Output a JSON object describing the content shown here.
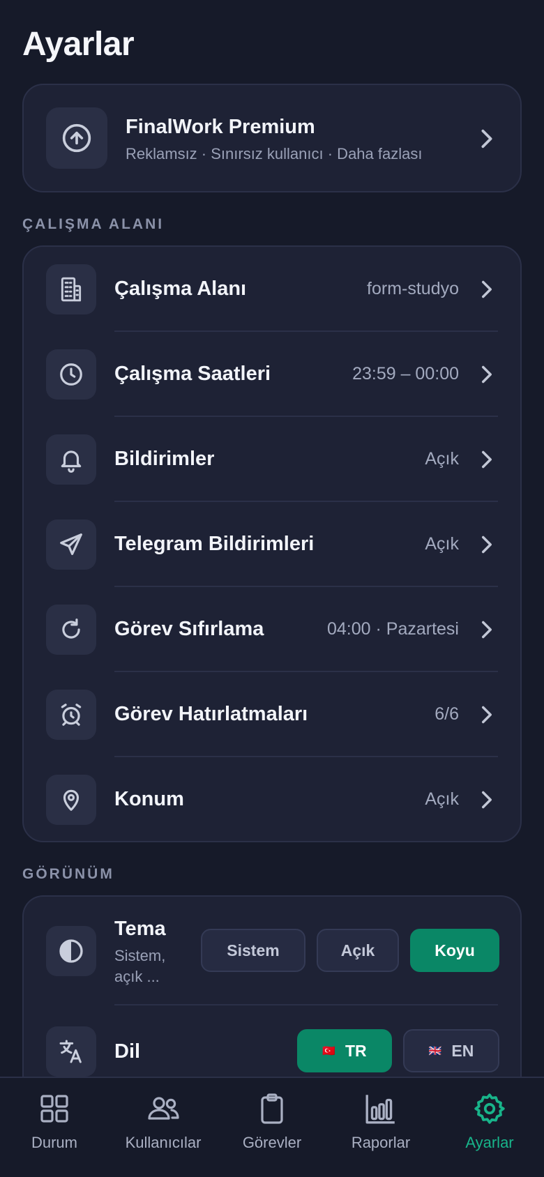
{
  "page_title": "Ayarlar",
  "premium": {
    "title": "FinalWork Premium",
    "subtitle": "Reklamsız · Sınırsız kullanıcı · Daha fazlası",
    "icon": "arrow-up-circle-icon"
  },
  "workspace_section": {
    "label": "ÇALIŞMA ALANI",
    "rows": [
      {
        "label": "Çalışma Alanı",
        "value": "form-studyo",
        "icon": "building-icon"
      },
      {
        "label": "Çalışma Saatleri",
        "value": "23:59 – 00:00",
        "icon": "clock-icon"
      },
      {
        "label": "Bildirimler",
        "value": "Açık",
        "icon": "bell-icon"
      },
      {
        "label": "Telegram Bildirimleri",
        "value": "Açık",
        "icon": "send-icon"
      },
      {
        "label": "Görev Sıfırlama",
        "value": "04:00 · Pazartesi",
        "icon": "refresh-icon"
      },
      {
        "label": "Görev Hatırlatmaları",
        "value": "6/6",
        "icon": "alarm-clock-icon"
      },
      {
        "label": "Konum",
        "value": "Açık",
        "icon": "location-pin-icon"
      }
    ]
  },
  "appearance_section": {
    "label": "GÖRÜNÜM",
    "theme": {
      "label": "Tema",
      "subtitle": "Sistem, açık ...",
      "options": [
        "Sistem",
        "Açık",
        "Koyu"
      ],
      "selected": "Koyu"
    },
    "language": {
      "label": "Dil",
      "options": [
        {
          "code": "TR",
          "flag": "🇹🇷"
        },
        {
          "code": "EN",
          "flag": "🇬🇧"
        }
      ],
      "selected": "TR"
    }
  },
  "bottom_nav": {
    "items": [
      {
        "label": "Durum",
        "icon": "grid-icon"
      },
      {
        "label": "Kullanıcılar",
        "icon": "users-icon"
      },
      {
        "label": "Görevler",
        "icon": "clipboard-icon"
      },
      {
        "label": "Raporlar",
        "icon": "bar-chart-icon"
      },
      {
        "label": "Ayarlar",
        "icon": "gear-icon"
      }
    ],
    "active": "Ayarlar"
  },
  "colors": {
    "background": "#161a29",
    "card": "#1e2235",
    "accent": "#0a8766",
    "accent_text": "#18b48a"
  }
}
